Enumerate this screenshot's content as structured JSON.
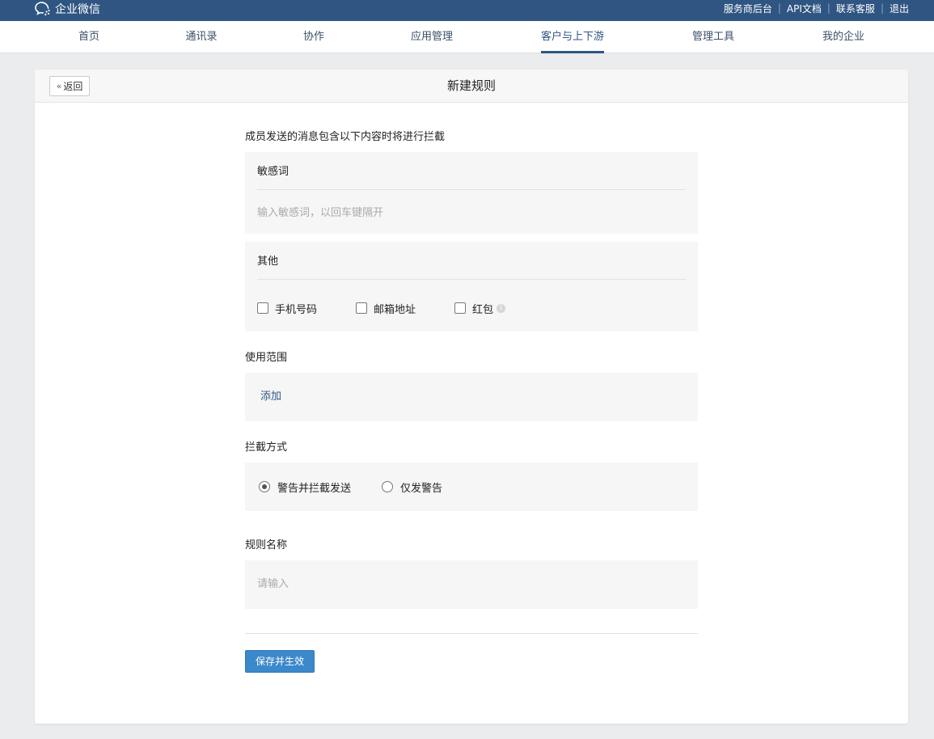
{
  "app": {
    "name": "企业微信"
  },
  "top_links": [
    "服务商后台",
    "API文档",
    "联系客服",
    "退出"
  ],
  "nav": {
    "items": [
      "首页",
      "通讯录",
      "协作",
      "应用管理",
      "客户与上下游",
      "管理工具",
      "我的企业"
    ],
    "active_index": 4
  },
  "panel": {
    "back_label": "返回",
    "title": "新建规则"
  },
  "form": {
    "intercept_intro": "成员发送的消息包含以下内容时将进行拦截",
    "keywords": {
      "label": "敏感词",
      "placeholder": "输入敏感词，以回车键隔开"
    },
    "other": {
      "label": "其他",
      "options": [
        {
          "label": "手机号码",
          "checked": false
        },
        {
          "label": "邮箱地址",
          "checked": false
        },
        {
          "label": "红包",
          "checked": false
        }
      ]
    },
    "scope": {
      "label": "使用范围",
      "add_label": "添加"
    },
    "method": {
      "label": "拦截方式",
      "options": [
        {
          "label": "警告并拦截发送",
          "selected": true
        },
        {
          "label": "仅发警告",
          "selected": false
        }
      ]
    },
    "rule_name": {
      "label": "规则名称",
      "placeholder": "请输入"
    },
    "save_label": "保存并生效"
  },
  "colors": {
    "brand": "#2f5582",
    "primary_button": "#3b88cb",
    "page_bg": "#ebecee",
    "box_bg": "#f6f6f6"
  }
}
